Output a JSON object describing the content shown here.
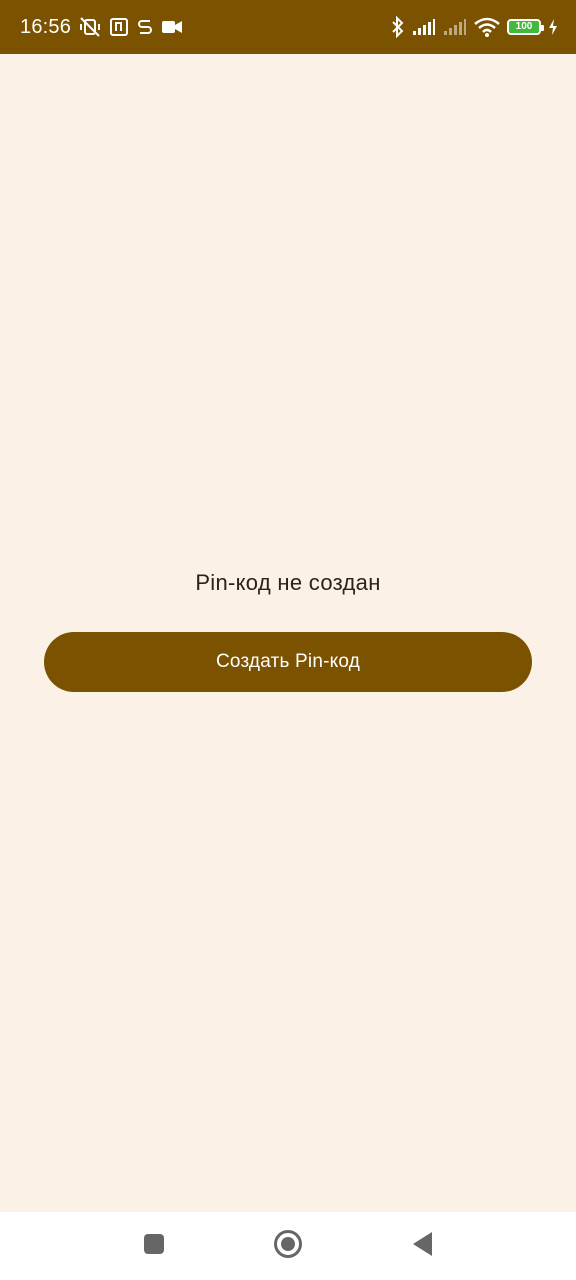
{
  "status_bar": {
    "time": "16:56",
    "battery_level": "100",
    "icons": [
      "mute-vibrate-icon",
      "nfc-icon",
      "s-app-icon",
      "video-camera-icon",
      "bluetooth-icon",
      "signal-icon",
      "signal-icon-2",
      "wifi-icon",
      "battery-icon",
      "charging-icon"
    ],
    "background_color": "#7b5200"
  },
  "main": {
    "status_message": "Pin-код не создан",
    "create_button_label": "Создать Pin-код",
    "background_color": "#fbf1e6",
    "accent_color": "#7b5200"
  },
  "nav_bar": {
    "icons": [
      "recent-apps-icon",
      "home-icon",
      "back-icon"
    ]
  }
}
